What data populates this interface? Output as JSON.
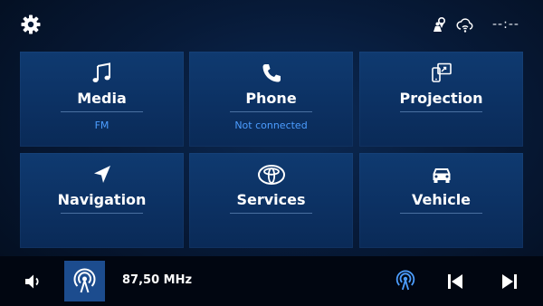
{
  "header": {
    "clock": "--:--",
    "icons": [
      "gear-icon",
      "person-location-icon",
      "cloud-wifi-icon"
    ]
  },
  "tiles": [
    {
      "label": "Media",
      "sub": "FM",
      "icon": "music-note-icon"
    },
    {
      "label": "Phone",
      "sub": "Not connected",
      "icon": "phone-icon"
    },
    {
      "label": "Projection",
      "sub": "",
      "icon": "projection-icon"
    },
    {
      "label": "Navigation",
      "sub": "",
      "icon": "navigation-arrow-icon"
    },
    {
      "label": "Services",
      "sub": "",
      "icon": "toyota-logo-icon"
    },
    {
      "label": "Vehicle",
      "sub": "",
      "icon": "car-icon"
    }
  ],
  "player": {
    "frequency": "87,50 MHz",
    "icons": [
      "volume-icon",
      "radio-antenna-icon",
      "source-antenna-icon",
      "previous-track-icon",
      "next-track-icon"
    ]
  },
  "colors": {
    "accent": "#4c9dff",
    "tile": "#0c3163",
    "radio_button": "#1c4c8e",
    "background": "#020912"
  }
}
